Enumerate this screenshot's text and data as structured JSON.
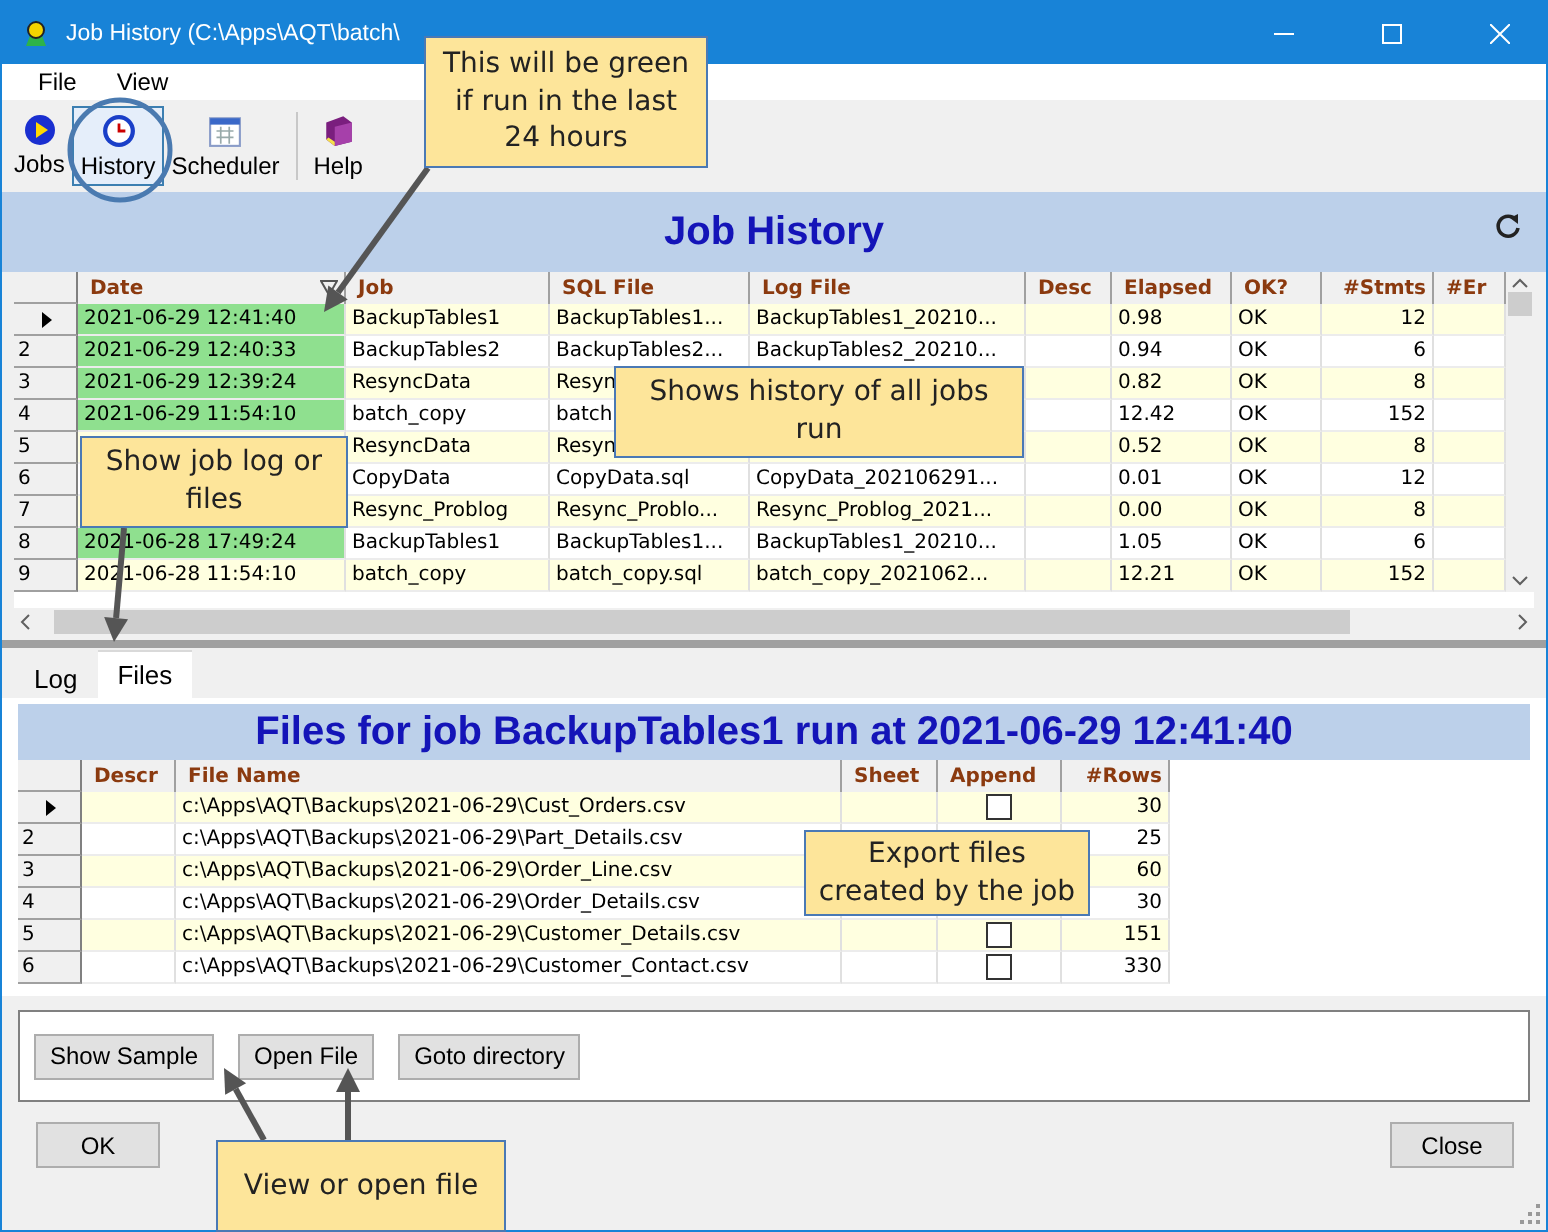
{
  "window": {
    "title": "Job History (C:\\Apps\\AQT\\batch\\"
  },
  "menu": [
    "File",
    "View"
  ],
  "toolbar": [
    {
      "label": "Jobs",
      "kind": "play",
      "selected": false
    },
    {
      "label": "History",
      "kind": "clock",
      "selected": true
    },
    {
      "label": "Scheduler",
      "kind": "calendar",
      "selected": false
    },
    {
      "label": "Help",
      "kind": "book",
      "selected": false
    }
  ],
  "history": {
    "title": "Job History",
    "columns": [
      "Date",
      "Job",
      "SQL File",
      "Log File",
      "Desc",
      "Elapsed",
      "OK?",
      "#Stmts",
      "#Er"
    ],
    "rows": [
      {
        "current": true,
        "recent": true,
        "date": "2021-06-29 12:41:40",
        "job": "BackupTables1",
        "sql_file": "BackupTables1...",
        "log_file": "BackupTables1_20210...",
        "elapsed": "0.98",
        "ok": "OK",
        "stmts": "12"
      },
      {
        "number": "2",
        "current": false,
        "recent": true,
        "date": "2021-06-29 12:40:33",
        "job": "BackupTables2",
        "sql_file": "BackupTables2...",
        "log_file": "BackupTables2_20210...",
        "elapsed": "0.94",
        "ok": "OK",
        "stmts": "6"
      },
      {
        "number": "3",
        "current": false,
        "recent": true,
        "date": "2021-06-29 12:39:24",
        "job": "ResyncData",
        "sql_file": "Resyn",
        "elapsed": "0.82",
        "ok": "OK",
        "stmts": "8"
      },
      {
        "number": "4",
        "current": false,
        "recent": true,
        "date": "2021-06-29 11:54:10",
        "job": "batch_copy",
        "sql_file": "batch",
        "elapsed": "12.42",
        "ok": "OK",
        "stmts": "152"
      },
      {
        "number": "5",
        "current": false,
        "job": "ResyncData",
        "sql_file": "Resyn",
        "elapsed": "0.52",
        "ok": "OK",
        "stmts": "8"
      },
      {
        "number": "6",
        "current": false,
        "job": "CopyData",
        "sql_file": "CopyData.sql",
        "log_file": "CopyData_202106291...",
        "elapsed": "0.01",
        "ok": "OK",
        "stmts": "12"
      },
      {
        "number": "7",
        "current": false,
        "job": "Resync_Problog",
        "sql_file": "Resync_Problo...",
        "log_file": "Resync_Problog_2021...",
        "elapsed": "0.00",
        "ok": "OK",
        "stmts": "8"
      },
      {
        "number": "8",
        "current": false,
        "recent": true,
        "date": "2021-06-28 17:49:24",
        "job": "BackupTables1",
        "sql_file": "BackupTables1...",
        "log_file": "BackupTables1_20210...",
        "elapsed": "1.05",
        "ok": "OK",
        "stmts": "6"
      },
      {
        "number": "9",
        "current": false,
        "recent": false,
        "date": "2021-06-28 11:54:10",
        "job": "batch_copy",
        "sql_file": "batch_copy.sql",
        "log_file": "batch_copy_2021062...",
        "elapsed": "12.21",
        "ok": "OK",
        "stmts": "152"
      }
    ]
  },
  "tabs": [
    {
      "label": "Log",
      "selected": false
    },
    {
      "label": "Files",
      "selected": true
    }
  ],
  "files": {
    "title": "Files for job BackupTables1 run at 2021-06-29 12:41:40",
    "columns": [
      "Descr",
      "File Name",
      "Sheet",
      "Append",
      "#Rows"
    ],
    "rows": [
      {
        "current": true,
        "file_name": "c:\\Apps\\AQT\\Backups\\2021-06-29\\Cust_Orders.csv",
        "append": false,
        "rows": "30"
      },
      {
        "number": "2",
        "current": false,
        "file_name": "c:\\Apps\\AQT\\Backups\\2021-06-29\\Part_Details.csv",
        "rows": "25"
      },
      {
        "number": "3",
        "current": false,
        "file_name": "c:\\Apps\\AQT\\Backups\\2021-06-29\\Order_Line.csv",
        "rows": "60"
      },
      {
        "number": "4",
        "current": false,
        "file_name": "c:\\Apps\\AQT\\Backups\\2021-06-29\\Order_Details.csv",
        "rows": "30"
      },
      {
        "number": "5",
        "current": false,
        "file_name": "c:\\Apps\\AQT\\Backups\\2021-06-29\\Customer_Details.csv",
        "append": false,
        "rows": "151"
      },
      {
        "number": "6",
        "current": false,
        "file_name": "c:\\Apps\\AQT\\Backups\\2021-06-29\\Customer_Contact.csv",
        "append": false,
        "rows": "330"
      }
    ],
    "buttons": [
      "Show Sample",
      "Open File",
      "Goto directory"
    ]
  },
  "footer_buttons": [
    "OK",
    "Close"
  ],
  "callouts": [
    "This will be green if run in the last 24 hours",
    "Shows history of all jobs run",
    "Show job log or files",
    "Export files created by the job",
    "View or open file"
  ]
}
